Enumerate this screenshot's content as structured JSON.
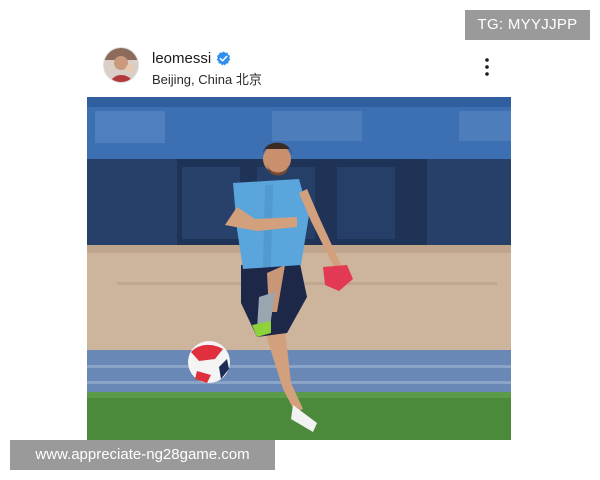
{
  "watermarks": {
    "top": "TG: MYYJJPP",
    "bottom": "www.appreciate-ng28game.com"
  },
  "post": {
    "username": "leomessi",
    "verified": true,
    "location": "Beijing, China 北京",
    "icons": {
      "avatar": "profile-avatar",
      "verified": "verified-badge-icon",
      "more": "more-options-icon"
    },
    "image": {
      "description_icon": "photo",
      "colors": {
        "banner": "#3d6fb3",
        "field": "#4b8a3a",
        "jersey": "#5aa6dc",
        "shorts": "#1d2748",
        "boot": "#8fd13a"
      }
    }
  }
}
